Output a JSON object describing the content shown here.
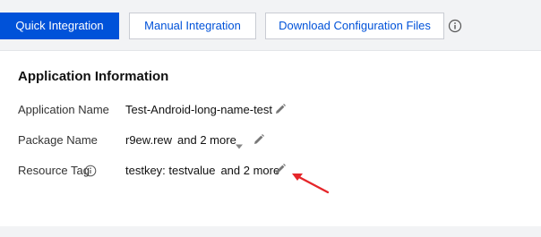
{
  "tabs": [
    {
      "label": "Quick Integration",
      "active": true
    },
    {
      "label": "Manual Integration",
      "active": false
    },
    {
      "label": "Download Configuration Files",
      "active": false
    }
  ],
  "icons": {
    "tab_info": "info-circle-icon",
    "edit": "pencil-icon",
    "dropdown": "caret-down-icon",
    "tag_info": "info-circle-icon",
    "annotation": "red-arrow-icon"
  },
  "card": {
    "title": "Application Information",
    "rows": {
      "name": {
        "label": "Application Name",
        "value": "Test-Android-long-name-test"
      },
      "package": {
        "label": "Package Name",
        "value": "r9ew.rew",
        "more": "and 2 more"
      },
      "tag": {
        "label": "Resource Tag",
        "value": "testkey: testvalue",
        "more": "and 2 more"
      }
    }
  },
  "colors": {
    "primary": "#0052d9",
    "annotation": "#e5262a",
    "icon": "#777777"
  }
}
